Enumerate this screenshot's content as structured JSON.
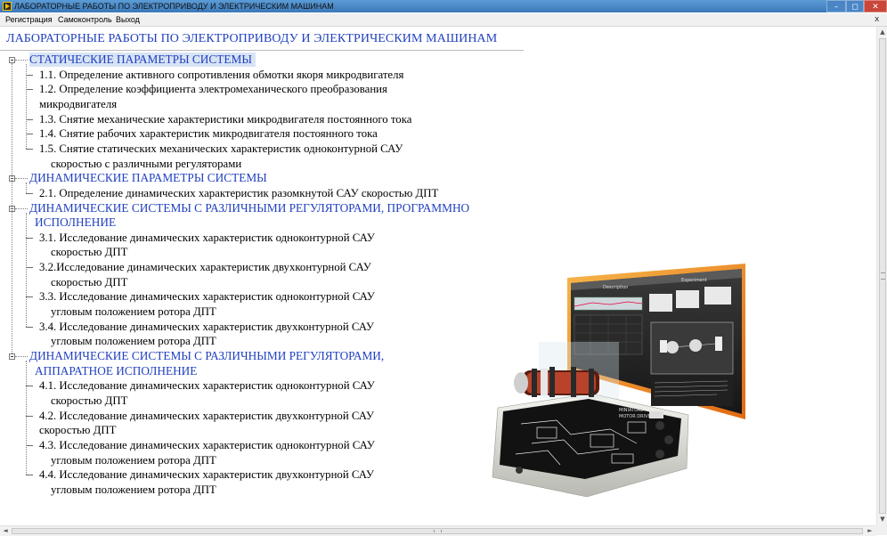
{
  "window": {
    "title": "ЛАБОРАТОРНЫЕ  РАБОТЫ ПО  ЭЛЕКТРОПРИВОДУ И ЭЛЕКТРИЧЕСКИМ  МАШИНАМ",
    "controls": {
      "minimize": "–",
      "maximize": "◻",
      "close": "✕"
    }
  },
  "menu": {
    "items": [
      "Регистрация",
      "Самоконтроль",
      "Выход"
    ],
    "close_glyph": "x"
  },
  "page": {
    "heading": "ЛАБОРАТОРНЫЕ  РАБОТЫ ПО  ЭЛЕКТРОПРИВОДУ И  ЭЛЕКТРИЧЕСКИМ  МАШИНАМ"
  },
  "tree": {
    "sections": [
      {
        "lines": [
          "СТАТИЧЕСКИЕ ПАРАМЕТРЫ СИСТЕМЫ"
        ],
        "items": [
          [
            "1.1. Определение активного сопротивления обмотки якоря микродвигателя"
          ],
          [
            "1.2. Определение коэффициента электромеханического преобразования",
            "микродвигателя"
          ],
          [
            "1.3. Снятие механические характеристики микродвигателя постоянного тока"
          ],
          [
            "1.4. Снятие рабочих характеристик  микродвигателя постоянного тока"
          ],
          [
            "1.5. Снятие статических механических характеристик одноконтурной САУ",
            "скоростью с различными регуляторами"
          ]
        ]
      },
      {
        "lines": [
          "ДИНАМИЧЕСКИЕ ПАРАМЕТРЫ СИСТЕМЫ"
        ],
        "items": [
          [
            "2.1. Определение динамических характеристик разомкнутой САУ скоростью ДПТ"
          ]
        ]
      },
      {
        "lines": [
          "ДИНАМИЧЕСКИЕ СИСТЕМЫ С РАЗЛИЧНЫМИ РЕГУЛЯТОРАМИ,  ПРОГРАММНО",
          "ИСПОЛНЕНИЕ"
        ],
        "items": [
          [
            "3.1. Исследование динамических характеристик одноконтурной САУ",
            "скоростью ДПТ"
          ],
          [
            "3.2.Исследование динамических характеристик двухконтурной САУ",
            "скоростью ДПТ"
          ],
          [
            "3.3. Исследование динамических характеристик одноконтурной САУ",
            "угловым положением ротора ДПТ"
          ],
          [
            "3.4. Исследование динамических характеристик двухконтурной САУ",
            "угловым положением ротора ДПТ"
          ]
        ]
      },
      {
        "lines": [
          "ДИНАМИЧЕСКИЕ СИСТЕМЫ С РАЗЛИЧНЫМИ РЕГУЛЯТОРАМИ,",
          "АППАРАТНОЕ ИСПОЛНЕНИЕ"
        ],
        "items": [
          [
            "4.1.  Исследование динамических характеристик одноконтурной САУ",
            "скоростью ДПТ"
          ],
          [
            "4.2. Исследование динамических характеристик двухконтурной САУ",
            "скоростью ДПТ"
          ],
          [
            "4.3. Исследование динамических характеристик одноконтурной САУ",
            "угловым положением ротора ДПТ"
          ],
          [
            "4.4. Исследование динамических характеристик двухконтурной САУ",
            "угловым положением ротора ДПТ"
          ]
        ]
      }
    ]
  },
  "illustration": {
    "screen_tabs": [
      "Description",
      "Experiment"
    ],
    "board_label": [
      "MINIATURE",
      "MOTOR DRIVER"
    ]
  },
  "scrollbars": {
    "up": "▲",
    "down": "▼",
    "left": "◄",
    "right": "►"
  },
  "colors": {
    "section_text": "#1f3fbf",
    "section_highlight": "#d8e4f5",
    "titlebar": "#3b78b8",
    "close_button": "#c9463a"
  }
}
